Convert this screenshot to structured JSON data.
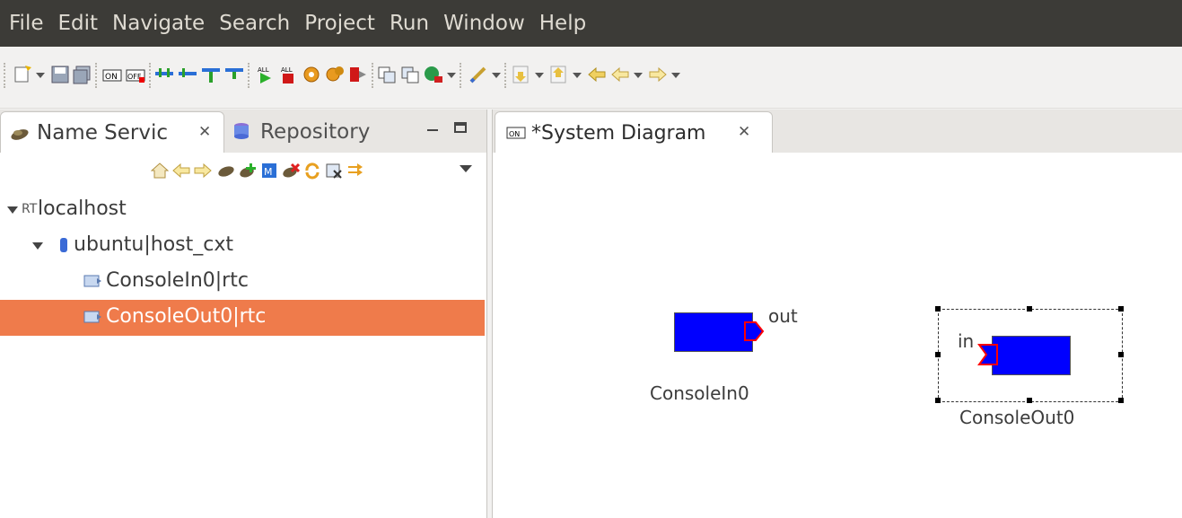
{
  "menubar": {
    "items": [
      "File",
      "Edit",
      "Navigate",
      "Search",
      "Project",
      "Run",
      "Window",
      "Help"
    ]
  },
  "toolbar": {
    "icons": [
      "new-icon",
      "save-icon",
      "save-all-icon",
      "activate-on-icon",
      "deactivate-off-icon",
      "connect-icon",
      "disconnect-icon",
      "port-icon",
      "port-icon",
      "start-all-icon",
      "stop-all-icon",
      "config-icon",
      "config-icon",
      "exit-icon",
      "layout-icon",
      "layout-icon",
      "run-icon",
      "edit-icon",
      "next-annotation-icon",
      "prev-annotation-icon",
      "back-icon",
      "back-icon",
      "forward-icon"
    ]
  },
  "left_panel": {
    "tab_active": "Name Servic",
    "tab_inactive": "Repository",
    "tree": [
      {
        "label": "localhost",
        "prefix": "RT",
        "level": 0,
        "expanded": true
      },
      {
        "label": "ubuntu|host_cxt",
        "level": 1,
        "expanded": true
      },
      {
        "label": "ConsoleIn0|rtc",
        "level": 2
      },
      {
        "label": "ConsoleOut0|rtc",
        "level": 2,
        "selected": true
      }
    ]
  },
  "right_panel": {
    "tab_title": "*System Diagram"
  },
  "diagram": {
    "components": [
      {
        "name": "ConsoleIn0",
        "port_label": "out",
        "port_kind": "out"
      },
      {
        "name": "ConsoleOut0",
        "port_label": "in",
        "port_kind": "in",
        "selected": true
      }
    ]
  },
  "colors": {
    "menubar_bg": "#3c3b37",
    "selection": "#ef7b4b",
    "component_fill": "#0000ff",
    "port_stroke": "#ff0000"
  }
}
